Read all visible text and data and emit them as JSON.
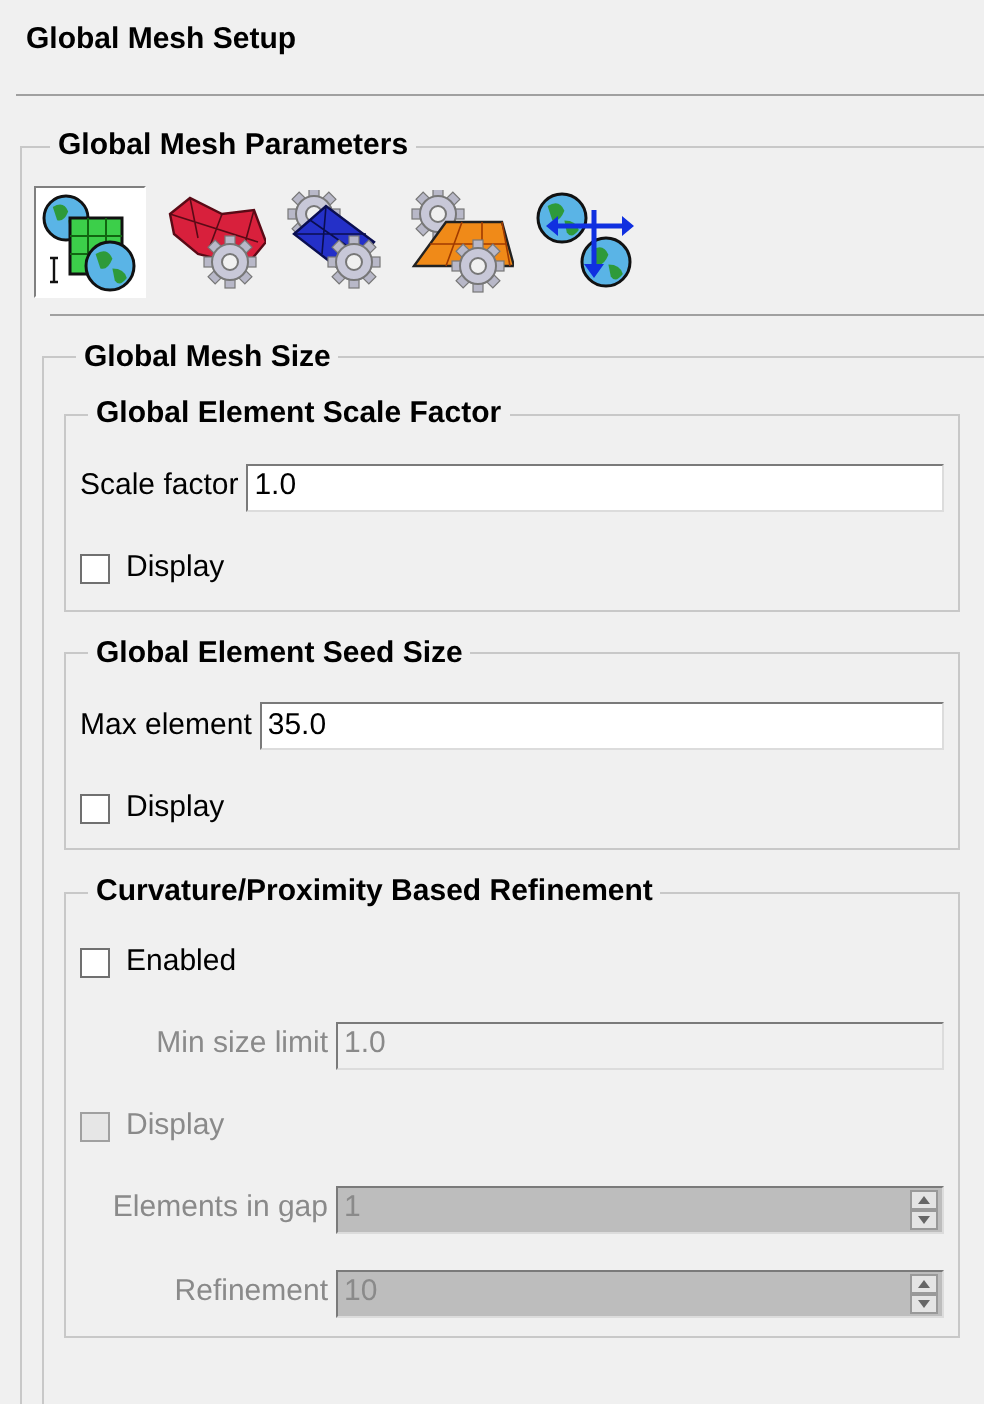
{
  "title": "Global Mesh Setup",
  "parameters": {
    "title": "Global Mesh Parameters",
    "tools": [
      {
        "kind": "globe-cube",
        "selected": true
      },
      {
        "kind": "red-mesh",
        "selected": false
      },
      {
        "kind": "blue-mesh",
        "selected": false
      },
      {
        "kind": "orange-mesh",
        "selected": false
      },
      {
        "kind": "globe-arrows",
        "selected": false
      }
    ]
  },
  "mesh_size": {
    "title": "Global Mesh Size",
    "groups": [
      {
        "title": "Global Element Scale Factor",
        "rows": [
          {
            "kind": "field",
            "label": "Scale factor",
            "value": "1.0",
            "disabled": false
          },
          {
            "kind": "checkbox",
            "label": "Display",
            "checked": false,
            "disabled": false
          }
        ]
      },
      {
        "title": "Global Element Seed Size",
        "rows": [
          {
            "kind": "field",
            "label": "Max element",
            "value": "35.0",
            "disabled": false
          },
          {
            "kind": "checkbox",
            "label": "Display",
            "checked": false,
            "disabled": false
          }
        ]
      },
      {
        "title": "Curvature/Proximity Based Refinement",
        "rows": [
          {
            "kind": "checkbox",
            "label": "Enabled",
            "checked": false,
            "disabled": false
          },
          {
            "kind": "field",
            "label": "Min size limit",
            "value": "1.0",
            "disabled": true,
            "aligned": true
          },
          {
            "kind": "checkbox",
            "label": "Display",
            "checked": false,
            "disabled": true
          },
          {
            "kind": "spinner",
            "label": "Elements in gap",
            "value": "1",
            "disabled": true,
            "aligned": true
          },
          {
            "kind": "spinner",
            "label": "Refinement",
            "value": "10",
            "disabled": true,
            "aligned": true
          }
        ]
      }
    ]
  }
}
